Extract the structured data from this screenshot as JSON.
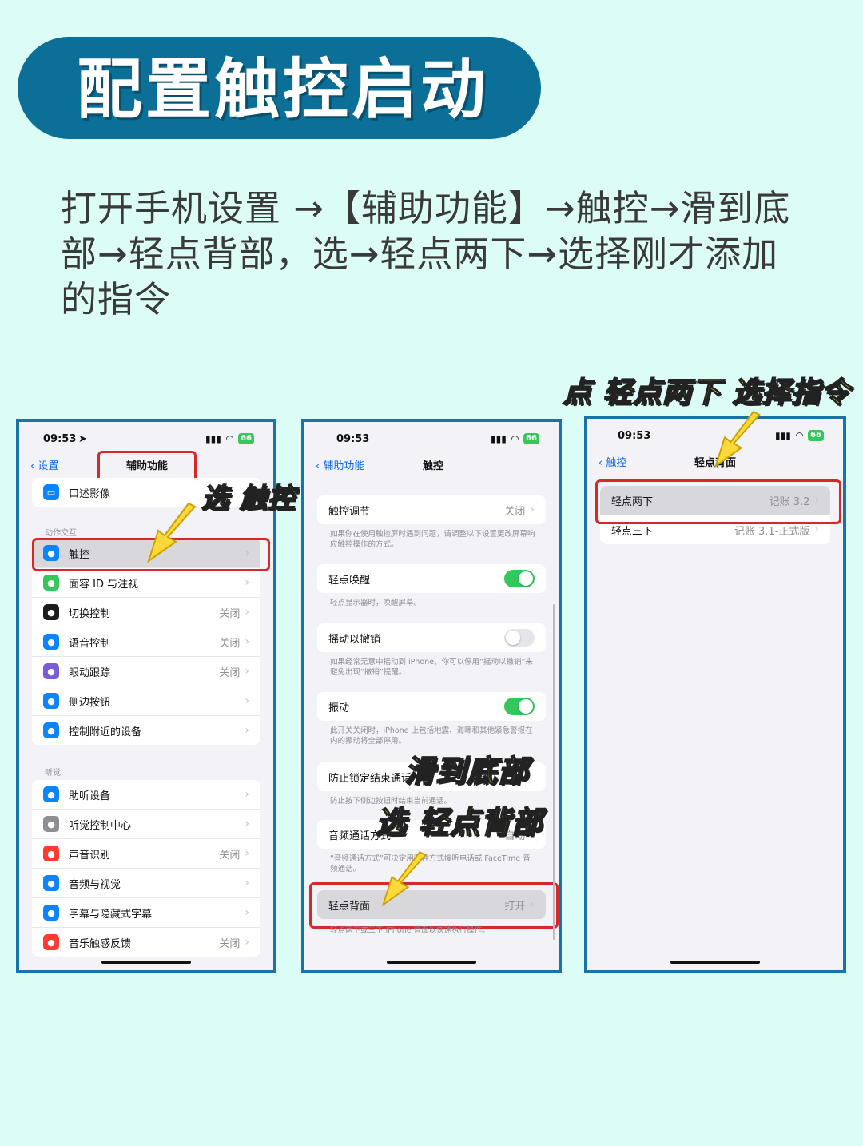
{
  "title": "配置触控启动",
  "instructions": "打开手机设置 →【辅助功能】→触控→滑到底部→轻点背部，选→轻点两下→选择刚才添加的指令",
  "callouts": {
    "select_touch": "选 触控",
    "tap_double": "点 轻点两下 选择指令",
    "scroll_bottom": "滑到底部",
    "select_back_tap": "选 轻点背部"
  },
  "colors": {
    "accent": "#0b6f97",
    "highlight": "#d42a2a",
    "callout": "#ffe13a",
    "ios_blue": "#0a64f5",
    "ios_green": "#34c759"
  },
  "phone1": {
    "time": "09:53",
    "battery": "66",
    "back_label": "设置",
    "nav_title": "辅助功能",
    "top_row": {
      "label": "口述影像",
      "icon": "audio-description-icon",
      "color": "#0a84ff"
    },
    "section_interaction": "动作交互",
    "interaction_rows": [
      {
        "label": "触控",
        "value": "",
        "icon": "hand-touch-icon",
        "color": "#0a84ff"
      },
      {
        "label": "面容 ID 与注视",
        "value": "",
        "icon": "face-id-icon",
        "color": "#34c759"
      },
      {
        "label": "切换控制",
        "value": "关闭",
        "icon": "switch-control-icon",
        "color": "#1c1c1e"
      },
      {
        "label": "语音控制",
        "value": "关闭",
        "icon": "voice-control-icon",
        "color": "#0a84ff"
      },
      {
        "label": "眼动跟踪",
        "value": "关闭",
        "icon": "eye-tracking-icon",
        "color": "#7d5bd8"
      },
      {
        "label": "侧边按钮",
        "value": "",
        "icon": "side-button-icon",
        "color": "#0a84ff"
      },
      {
        "label": "控制附近的设备",
        "value": "",
        "icon": "nearby-device-icon",
        "color": "#0a84ff"
      }
    ],
    "section_hearing": "听觉",
    "hearing_rows": [
      {
        "label": "助听设备",
        "value": "",
        "icon": "ear-icon",
        "color": "#0a84ff"
      },
      {
        "label": "听觉控制中心",
        "value": "",
        "icon": "hearing-control-icon",
        "color": "#8e8e93"
      },
      {
        "label": "声音识别",
        "value": "关闭",
        "icon": "sound-recognition-icon",
        "color": "#ff3b30"
      },
      {
        "label": "音频与视觉",
        "value": "",
        "icon": "speaker-icon",
        "color": "#0a84ff"
      },
      {
        "label": "字幕与隐藏式字幕",
        "value": "",
        "icon": "captions-icon",
        "color": "#0a84ff"
      },
      {
        "label": "音乐触感反馈",
        "value": "关闭",
        "icon": "music-haptics-icon",
        "color": "#ff3b30"
      }
    ]
  },
  "phone2": {
    "time": "09:53",
    "battery": "66",
    "back_label": "辅助功能",
    "nav_title": "触控",
    "touch_accommodations": {
      "label": "触控调节",
      "value": "关闭",
      "note": "如果你在使用触控屏时遇到问题，请调整以下设置更改屏幕响应触控操作的方式。"
    },
    "tap_to_wake": {
      "label": "轻点唤醒",
      "state": "on",
      "note": "轻点显示器时，唤醒屏幕。"
    },
    "shake_to_undo": {
      "label": "摇动以撤销",
      "state": "off",
      "note": "如果经常无意中摇动到 iPhone，你可以停用“摇动以撤销”来避免出现“撤销”提醒。"
    },
    "vibration": {
      "label": "振动",
      "state": "on",
      "note": "此开关关闭时，iPhone 上包括地震、海啸和其他紧急警报在内的振动将全部停用。"
    },
    "prevent_lock": {
      "label": "防止锁定结束通话",
      "note": "防止按下侧边按钮时结束当前通话。"
    },
    "call_audio": {
      "label": "音频通话方式",
      "value": "自动",
      "note": "“音频通话方式”可决定用哪种方式接听电话或 FaceTime 音频通话。"
    },
    "back_tap": {
      "label": "轻点背面",
      "value": "打开",
      "note": "轻点两下或三下 iPhone 背面以快速执行操作。"
    }
  },
  "phone3": {
    "time": "09:53",
    "battery": "66",
    "back_label": "触控",
    "nav_title": "轻点背面",
    "rows": [
      {
        "label": "轻点两下",
        "value": "记账 3.2"
      },
      {
        "label": "轻点三下",
        "value": "记账 3.1-正式版"
      }
    ]
  }
}
